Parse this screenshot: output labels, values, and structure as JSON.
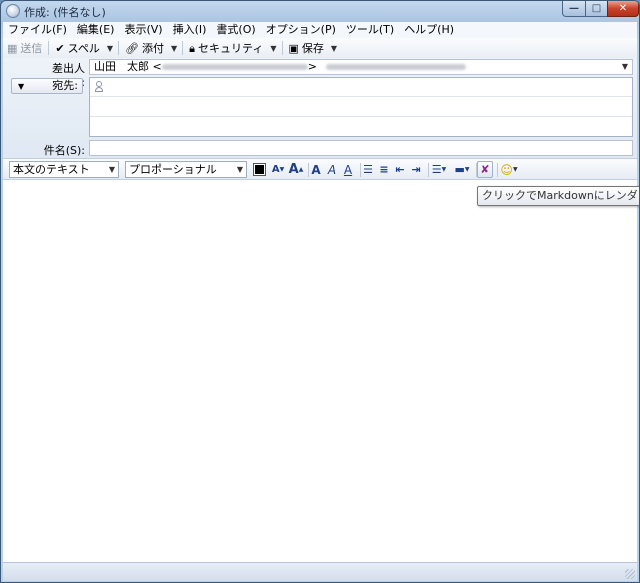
{
  "window": {
    "title": "作成: (件名なし)",
    "min_glyph": "—",
    "max_glyph": "□",
    "close_glyph": "✕"
  },
  "menu": [
    {
      "label": "ファイル(F)"
    },
    {
      "label": "編集(E)"
    },
    {
      "label": "表示(V)"
    },
    {
      "label": "挿入(I)"
    },
    {
      "label": "書式(O)"
    },
    {
      "label": "オプション(P)"
    },
    {
      "label": "ツール(T)"
    },
    {
      "label": "ヘルプ(H)"
    }
  ],
  "toolbar": {
    "send_label": "送信",
    "spell_label": "スペル",
    "attach_label": "添付",
    "security_label": "セキュリティ",
    "save_label": "保存"
  },
  "header": {
    "from_label": "差出人(R):",
    "from_name": "山田　太郎 <",
    "from_close": ">",
    "to_label": "宛先:",
    "subject_label": "件名(S):",
    "subject_value": ""
  },
  "format": {
    "paragraph_style": "本文のテキスト",
    "font": "プロポーショナル"
  },
  "tooltip": "クリックでMarkdownにレンダリング",
  "colors": {
    "accent": "#1f3f86",
    "markdown_icon": "#8c2a7e"
  }
}
